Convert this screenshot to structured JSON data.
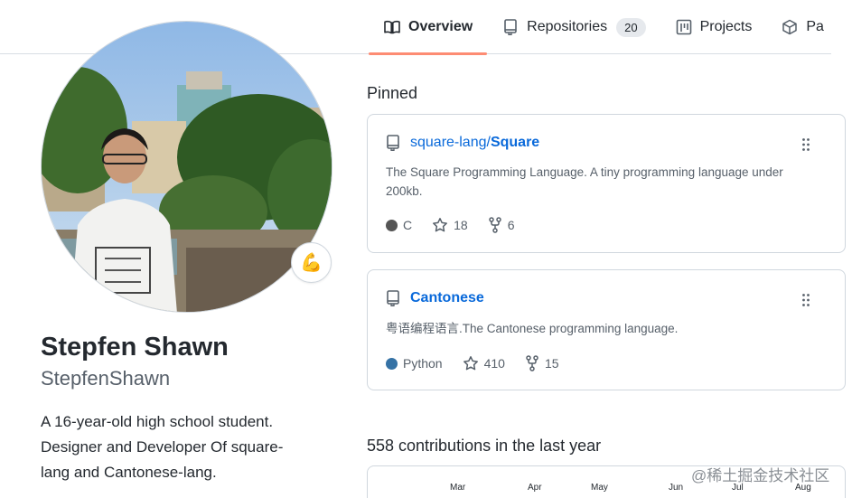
{
  "tabs": [
    {
      "label": "Overview",
      "icon": "book-icon",
      "active": true
    },
    {
      "label": "Repositories",
      "icon": "repo-icon",
      "count": "20"
    },
    {
      "label": "Projects",
      "icon": "project-icon"
    },
    {
      "label": "Pa",
      "icon": "package-icon"
    }
  ],
  "profile": {
    "full_name": "Stepfen Shawn",
    "username": "StepfenShawn",
    "status_emoji": "💪",
    "bio_lines": [
      "A 16-year-old high school student.",
      "Designer and Developer Of square-",
      "lang and Cantonese-lang."
    ]
  },
  "pinned": {
    "title": "Pinned",
    "repos": [
      {
        "owner": "square-lang/",
        "name": "Square",
        "description_lines": [
          "The Square Programming Language. A tiny programming language under",
          "200kb."
        ],
        "language": "C",
        "language_color": "#555555",
        "stars": "18",
        "forks": "6"
      },
      {
        "owner": "",
        "name": "Cantonese",
        "description_lines": [
          "粤语编程语言.The Cantonese programming language."
        ],
        "language": "Python",
        "language_color": "#3572A5",
        "stars": "410",
        "forks": "15"
      }
    ]
  },
  "contributions": {
    "title": "558 contributions in the last year",
    "months": [
      "Mar",
      "Apr",
      "May",
      "Jun",
      "Jul",
      "Aug"
    ]
  },
  "watermark": "@稀土掘金技术社区",
  "colors": {
    "link": "#0969da",
    "active_tab_underline": "#fd8c73",
    "border": "#d0d7de"
  }
}
